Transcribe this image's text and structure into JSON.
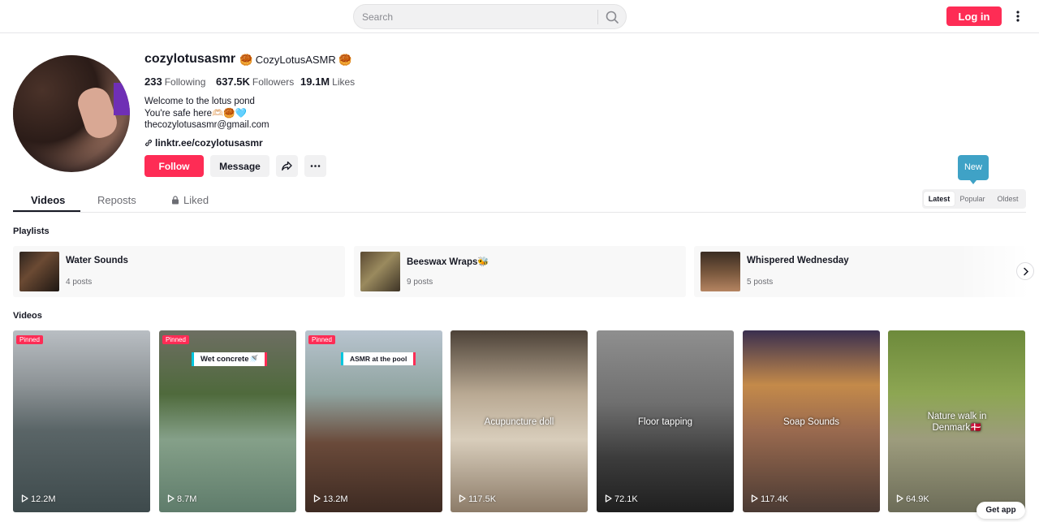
{
  "search": {
    "placeholder": "Search"
  },
  "header": {
    "login_label": "Log in"
  },
  "profile": {
    "username": "cozylotusasmr",
    "nickname": "🥮 CozyLotusASMR 🥮",
    "stats": [
      {
        "value": "233",
        "label": "Following"
      },
      {
        "value": "637.5K",
        "label": "Followers"
      },
      {
        "value": "19.1M",
        "label": "Likes"
      }
    ],
    "bio": [
      "Welcome to the lotus pond",
      "You're safe here🫶🏻🥮🩵",
      "thecozylotusasmr@gmail.com"
    ],
    "link": "linktr.ee/cozylotusasmr",
    "follow_label": "Follow",
    "message_label": "Message"
  },
  "tabs": [
    {
      "label": "Videos",
      "active": true
    },
    {
      "label": "Reposts",
      "active": false
    },
    {
      "label": "Liked",
      "active": false
    }
  ],
  "sort": {
    "tooltip": "New",
    "options": [
      {
        "label": "Latest",
        "active": true
      },
      {
        "label": "Popular",
        "active": false
      },
      {
        "label": "Oldest",
        "active": false
      }
    ]
  },
  "playlists": {
    "title": "Playlists",
    "items": [
      {
        "name": "Water Sounds",
        "count": "4 posts"
      },
      {
        "name": "Beeswax Wraps🐝",
        "count": "9 posts"
      },
      {
        "name": "Whispered Wednesday",
        "count": "5 posts"
      }
    ]
  },
  "videos": {
    "title": "Videos",
    "pinned_label": "Pinned",
    "items": [
      {
        "views": "12.2M",
        "pinned": true,
        "caption": "",
        "sticker": ""
      },
      {
        "views": "8.7M",
        "pinned": true,
        "caption": "",
        "sticker": "Wet concrete🚿"
      },
      {
        "views": "13.2M",
        "pinned": true,
        "caption": "",
        "sticker": "ASMR at the pool"
      },
      {
        "views": "117.5K",
        "pinned": false,
        "caption": "Acupuncture doll",
        "sticker": ""
      },
      {
        "views": "72.1K",
        "pinned": false,
        "caption": "Floor tapping",
        "sticker": ""
      },
      {
        "views": "117.4K",
        "pinned": false,
        "caption": "Soap Sounds",
        "sticker": ""
      },
      {
        "views": "64.9K",
        "pinned": false,
        "caption": "Nature walk in Denmark🇩🇰",
        "sticker": ""
      }
    ]
  },
  "get_app_label": "Get app",
  "colors": {
    "accent": "#fe2c55",
    "tooltip": "#3fa2c6"
  }
}
